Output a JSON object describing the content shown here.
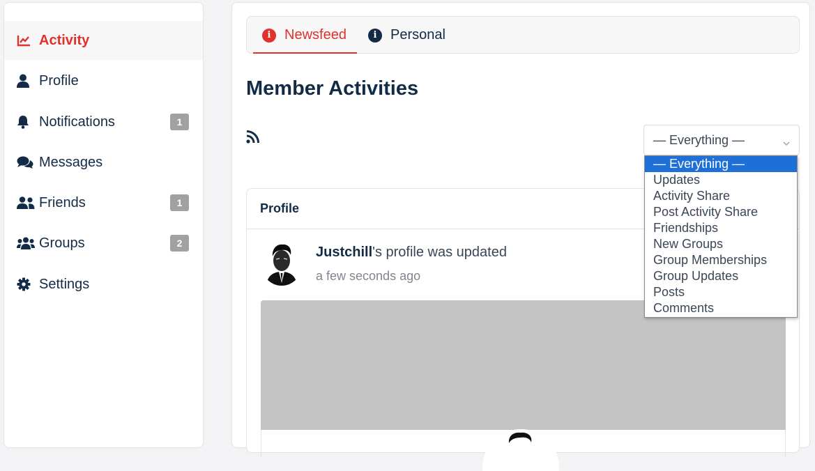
{
  "sidebar": {
    "items": [
      {
        "label": "Activity",
        "icon": "chart-line-icon",
        "active": true
      },
      {
        "label": "Profile",
        "icon": "user-icon"
      },
      {
        "label": "Notifications",
        "icon": "bell-icon",
        "badge": "1"
      },
      {
        "label": "Messages",
        "icon": "comments-icon"
      },
      {
        "label": "Friends",
        "icon": "user-friends-icon",
        "badge": "1"
      },
      {
        "label": "Groups",
        "icon": "users-icon",
        "badge": "2"
      },
      {
        "label": "Settings",
        "icon": "gear-icon"
      }
    ]
  },
  "tabs": [
    {
      "label": "Newsfeed",
      "icon": "info-circle-icon",
      "active": true
    },
    {
      "label": "Personal",
      "icon": "info-circle-icon"
    }
  ],
  "page": {
    "title": "Member Activities",
    "filter_selected": "— Everything —"
  },
  "filter_options": [
    "— Everything —",
    "Updates",
    "Activity Share",
    "Post Activity Share",
    "Friendships",
    "New Groups",
    "Group Memberships",
    "Group Updates",
    "Posts",
    "Comments"
  ],
  "card": {
    "header": "Profile",
    "activity": {
      "user": "Justchill",
      "action": "'s profile was updated",
      "time": "a few seconds ago"
    }
  },
  "colors": {
    "accent": "#e0312c",
    "text_primary": "#122b46",
    "badge": "#a1a1a1",
    "select_highlight": "#1f6fd8",
    "cover": "#c4c4c4"
  }
}
